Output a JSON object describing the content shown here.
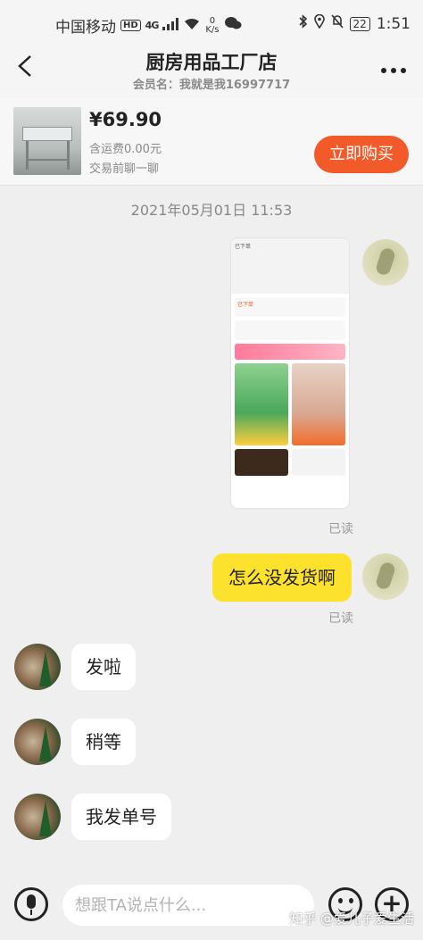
{
  "status_bar": {
    "carrier": "中国移动",
    "hd_badge": "HD",
    "network": "4G",
    "speed_value": "0",
    "speed_unit": "K/s",
    "battery": "22",
    "time": "1:51"
  },
  "header": {
    "title": "厨房用品工厂店",
    "subtitle": "会员名：我就是我16997717"
  },
  "product": {
    "price": "¥69.90",
    "shipping": "含运费0.00元",
    "note": "交易前聊一聊",
    "buy_label": "立即购买"
  },
  "chat": {
    "timestamp": "2021年05月01日 11:53",
    "screenshot_text": "已下单",
    "screenshot_status": "已下单",
    "read_label_1": "已读",
    "self_message": "怎么没发货啊",
    "read_label_2": "已读",
    "peer_messages": [
      "发啦",
      "稍等",
      "我发单号"
    ]
  },
  "input_bar": {
    "placeholder": "想跟TA说点什么..."
  },
  "watermark": "知乎 @爱儿子爱生活",
  "colors": {
    "buy_button": "#f25a2a",
    "self_bubble": "#fde22d",
    "peer_bubble": "#ffffff",
    "background": "#efefef"
  }
}
